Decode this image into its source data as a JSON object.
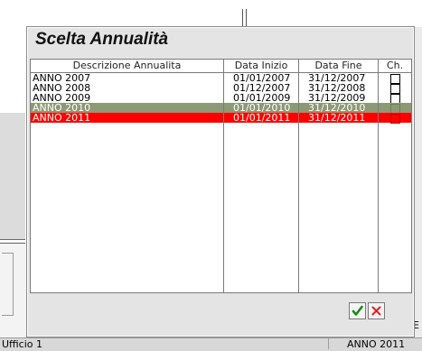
{
  "dialog": {
    "title": "Scelta Annualità",
    "columns": [
      "Descrizione Annualita",
      "Data Inizio",
      "Data Fine",
      "Ch."
    ],
    "rows": [
      {
        "descr": "ANNO 2007",
        "start": "01/01/2007",
        "end": "31/12/2007",
        "checked": false,
        "state": "normal"
      },
      {
        "descr": "ANNO 2008",
        "start": "01/12/2007",
        "end": "31/12/2008",
        "checked": false,
        "state": "normal"
      },
      {
        "descr": "ANNO 2009",
        "start": "01/01/2009",
        "end": "31/12/2009",
        "checked": false,
        "state": "normal"
      },
      {
        "descr": "ANNO 2010",
        "start": "01/01/2010",
        "end": "31/12/2010",
        "checked": false,
        "state": "highlighted"
      },
      {
        "descr": "ANNO 2011",
        "start": "01/01/2011",
        "end": "31/12/2011",
        "checked": false,
        "state": "selected"
      }
    ],
    "buttons": {
      "ok_icon": "checkmark-icon",
      "cancel_icon": "x-icon"
    },
    "colors": {
      "highlight": "#8b9a75",
      "selected": "#ff0000",
      "ok": "#1a8a1a",
      "cancel": "#e02020"
    }
  },
  "statusbar": {
    "left": "Ufficio 1",
    "right": "ANNO 2011"
  },
  "background": {
    "right_edge_char": "E"
  }
}
